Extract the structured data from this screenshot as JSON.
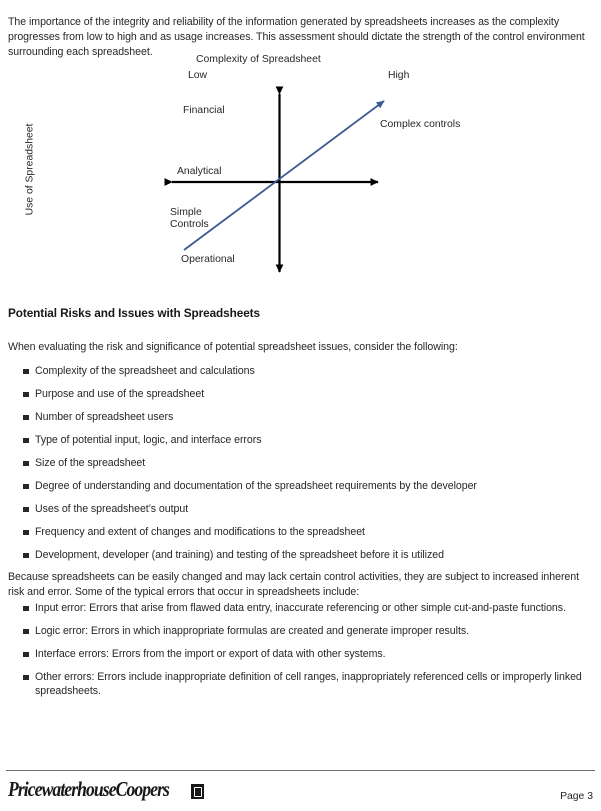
{
  "document": {
    "intro_paragraph": "The importance of the integrity and reliability of the information generated by spreadsheets increases as the complexity progresses from low to high and as usage increases.  This assessment should dictate the strength of the control environment surrounding each spreadsheet.",
    "section_heading": "Potential Risks and Issues with Spreadsheets",
    "lead_in_paragraph": "When evaluating the risk and significance of potential spreadsheet issues, consider the following:",
    "transition_paragraph": "Because spreadsheets can be easily changed and may lack certain control activities, they are subject to increased inherent risk and error.  Some of the typical errors that occur in spreadsheets include:",
    "risk_items": [
      "Complexity of the spreadsheet and calculations",
      "Purpose and use of the spreadsheet",
      "Number of spreadsheet users",
      "Type of potential input, logic, and interface errors",
      "Size of the spreadsheet",
      "Degree of understanding and documentation of the spreadsheet requirements by the developer",
      "Uses of the spreadsheet’s output",
      "Frequency and extent of changes and modifications to the spreadsheet",
      "Development, developer (and training) and testing of the spreadsheet before it is utilized"
    ],
    "error_items": [
      "Input error: Errors that arise from flawed data entry, inaccurate referencing or other simple cut-and-paste functions.",
      "Logic error: Errors in which inappropriate formulas are created and generate improper results.",
      "Interface errors: Errors from the import or export of data with other systems.",
      "Other errors: Errors include inappropriate definition of cell ranges, inappropriately referenced cells or improperly linked spreadsheets."
    ]
  },
  "diagram": {
    "title": "Complexity of Spreadsheet",
    "x_axis_low_label": "Low",
    "x_axis_high_label": "High",
    "y_axis_label": "Use of Spreadsheet",
    "quadrant_labels": {
      "top_left": "Financial",
      "middle_left": "Analytical",
      "lower_left": "Simple\nControls",
      "bottom_left": "Operational",
      "upper_right": "Complex controls"
    },
    "axis_color": "#000000",
    "trend_arrow_color": "#3b5a92"
  },
  "footer": {
    "logo_text": "PricewaterhouseCoopers",
    "logo_mark_name": "pwc-registered-mark",
    "page_label": "Page 3"
  }
}
